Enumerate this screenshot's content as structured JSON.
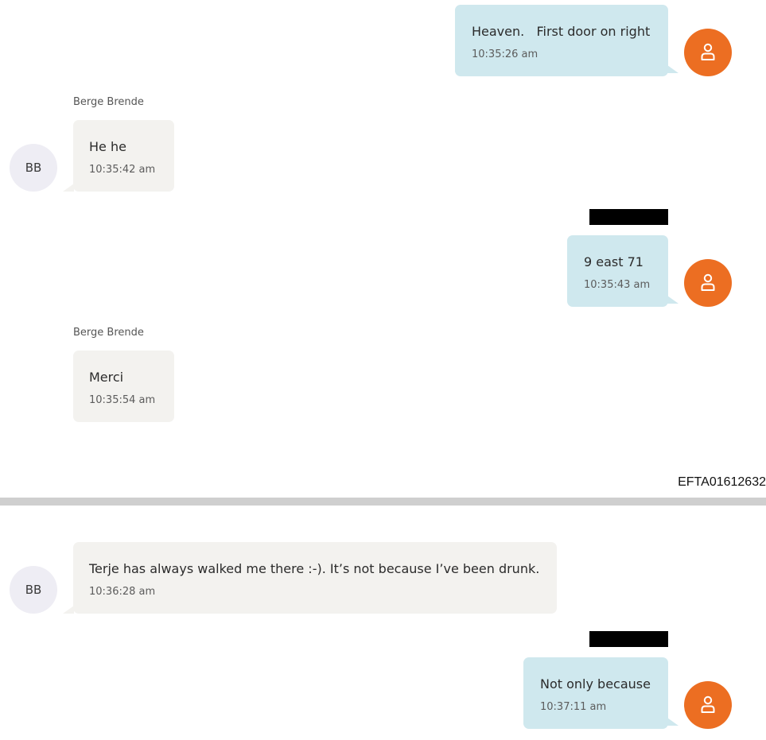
{
  "messages": [
    {
      "id": "m1",
      "direction": "outgoing",
      "text": "Heaven.   First door on right",
      "time": "10:35:26 am"
    },
    {
      "id": "m2",
      "direction": "incoming",
      "sender": "Berge Brende",
      "avatar_initials": "BB",
      "text": "He he",
      "time": "10:35:42 am"
    },
    {
      "id": "m3",
      "direction": "outgoing",
      "redacted_sender": true,
      "text": "9 east 71",
      "time": "10:35:43 am"
    },
    {
      "id": "m4",
      "direction": "incoming",
      "sender": "Berge Brende",
      "text": "Merci",
      "time": "10:35:54 am"
    },
    {
      "id": "m5",
      "direction": "incoming",
      "avatar_initials": "BB",
      "text": "Terje has always walked me there :-). It’s not because I’ve been drunk.",
      "time": "10:36:28 am"
    },
    {
      "id": "m6",
      "direction": "outgoing",
      "redacted_sender": true,
      "text": "Not only because",
      "time": "10:37:11 am"
    }
  ],
  "footer": {
    "document_id": "EFTA01612632"
  },
  "colors": {
    "outgoing_bubble": "#cfe8ee",
    "incoming_bubble": "#f3f2ef",
    "user_avatar": "#ec6e22",
    "contact_avatar": "#eeedf4"
  },
  "icons": {
    "user_avatar_icon": "person-outline-icon"
  }
}
